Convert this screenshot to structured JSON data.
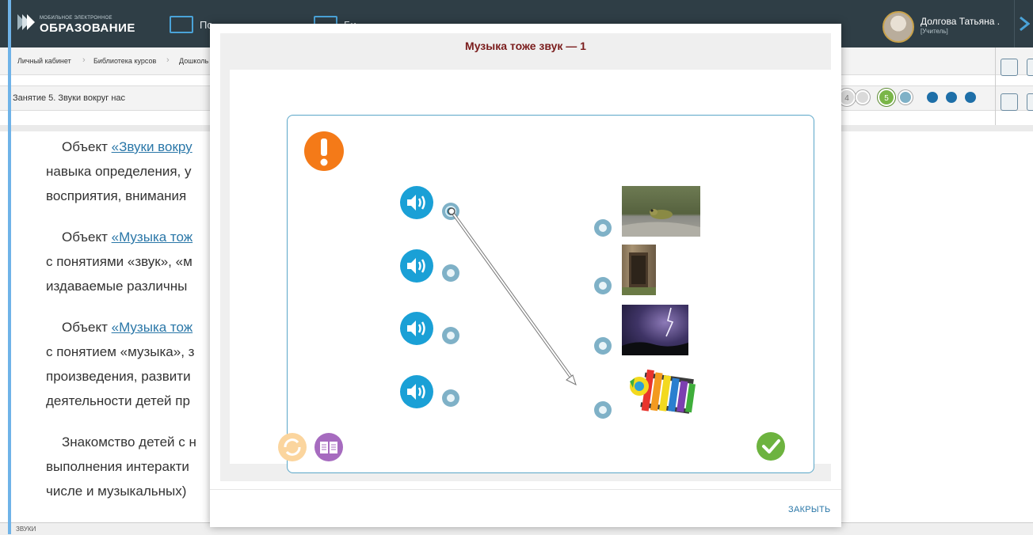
{
  "header": {
    "logo_small": "МОБИЛЬНОЕ ЭЛЕКТРОННОЕ",
    "logo_big": "ОБРАЗОВАНИЕ",
    "nav_items": [
      "По",
      "Би"
    ],
    "user_name": "Долгова Татьяна .",
    "user_role": "[Учитель]"
  },
  "breadcrumbs": [
    "Личный кабинет",
    "Библиотека курсов",
    "Дошколь"
  ],
  "lesson": {
    "title": "Занятие 5. Звуки вокруг нас",
    "steps": [
      "4",
      "5"
    ]
  },
  "content": {
    "paragraphs": [
      {
        "prefix": "Объект ",
        "link": "«Звуки вокру",
        "lines": [
          "навыка определения, у",
          "восприятия, внимания"
        ]
      },
      {
        "prefix": "Объект ",
        "link": "«Музыка тож",
        "lines": [
          "с понятиями «звук», «м",
          "издаваемые различны"
        ]
      },
      {
        "prefix": "Объект ",
        "link": "«Музыка тож",
        "lines": [
          "с понятием «музыка», з",
          "произведения, развити",
          "деятельности детей пр"
        ]
      },
      {
        "prefix": "Знакомство детей с н",
        "link": "",
        "lines": [
          "выполнения интеракти",
          "числе и музыкальных)"
        ]
      }
    ],
    "bottom_label": "ЗВУКИ"
  },
  "modal": {
    "title": "Музыка тоже звук — 1",
    "close_label": "ЗАКРЫТЬ",
    "colors": {
      "speaker": "#1aa0d6",
      "warning": "#f47a18",
      "check": "#6db33f",
      "refresh": "#fbd59e",
      "book": "#a66bbf"
    },
    "images": [
      {
        "name": "frog-photo"
      },
      {
        "name": "door-photo"
      },
      {
        "name": "lightning-photo"
      },
      {
        "name": "xylophone-picture"
      }
    ]
  }
}
